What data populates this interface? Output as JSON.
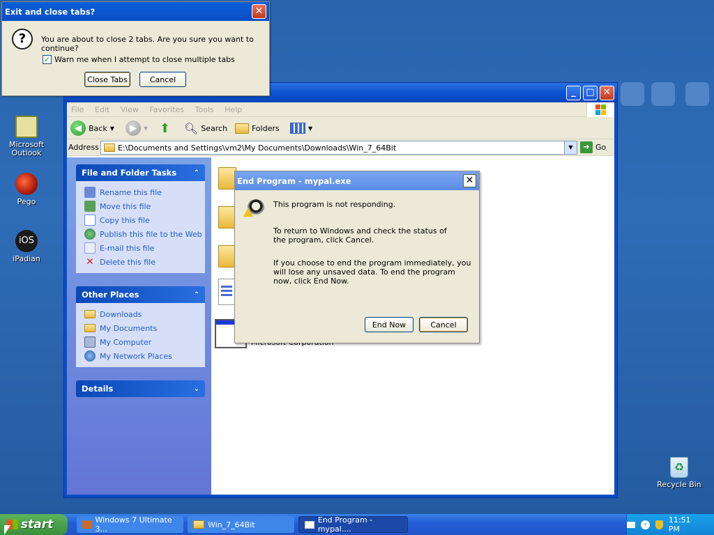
{
  "desktop": {
    "icons": [
      {
        "label_line1": "Microsoft",
        "label_line2": "Outlook"
      },
      {
        "label_line1": "Pego",
        "label_line2": ""
      },
      {
        "label_line1": "iPadian",
        "label_line2": "",
        "badge": "iOS"
      },
      {
        "label_line1": "Recycle Bin",
        "label_line2": ""
      }
    ]
  },
  "explorer": {
    "menu": [
      "File",
      "Edit",
      "View",
      "Favorites",
      "Tools",
      "Help"
    ],
    "toolbar": {
      "back": "Back",
      "search": "Search",
      "folders": "Folders"
    },
    "address": {
      "label": "Address",
      "value": "E:\\Documents and Settings\\vm2\\My Documents\\Downloads\\Win_7_64Bit",
      "go": "Go"
    },
    "file_tasks": {
      "title": "File and Folder Tasks",
      "items": [
        "Rename this file",
        "Move this file",
        "Copy this file",
        "Publish this file to the Web",
        "E-mail this file",
        "Delete this file"
      ]
    },
    "other_places": {
      "title": "Other Places",
      "items": [
        "Downloads",
        "My Documents",
        "My Computer",
        "My Network Places"
      ]
    },
    "details": {
      "title": "Details"
    },
    "content": {
      "file_company": "Microsoft Corporation"
    }
  },
  "tabs_dialog": {
    "title": "Exit and close tabs?",
    "message": "You are about to close 2 tabs. Are you sure you want to continue?",
    "checkbox_label": "Warn me when I attempt to close multiple tabs",
    "checkbox_checked": true,
    "close_tabs": "Close Tabs",
    "cancel": "Cancel"
  },
  "end_dialog": {
    "title": "End Program - mypal.exe",
    "line1": "This program is not responding.",
    "line2": "To return to Windows and check the status of the program, click Cancel.",
    "line3": "If you choose to end the program immediately, you will lose any unsaved data. To end the program now, click End Now.",
    "end_now": "End Now",
    "cancel": "Cancel"
  },
  "taskbar": {
    "start": "start",
    "tasks": [
      "Windows 7 Ultimate 3...",
      "Win_7_64Bit",
      "End Program - mypal...."
    ],
    "clock": "11:51 PM"
  }
}
